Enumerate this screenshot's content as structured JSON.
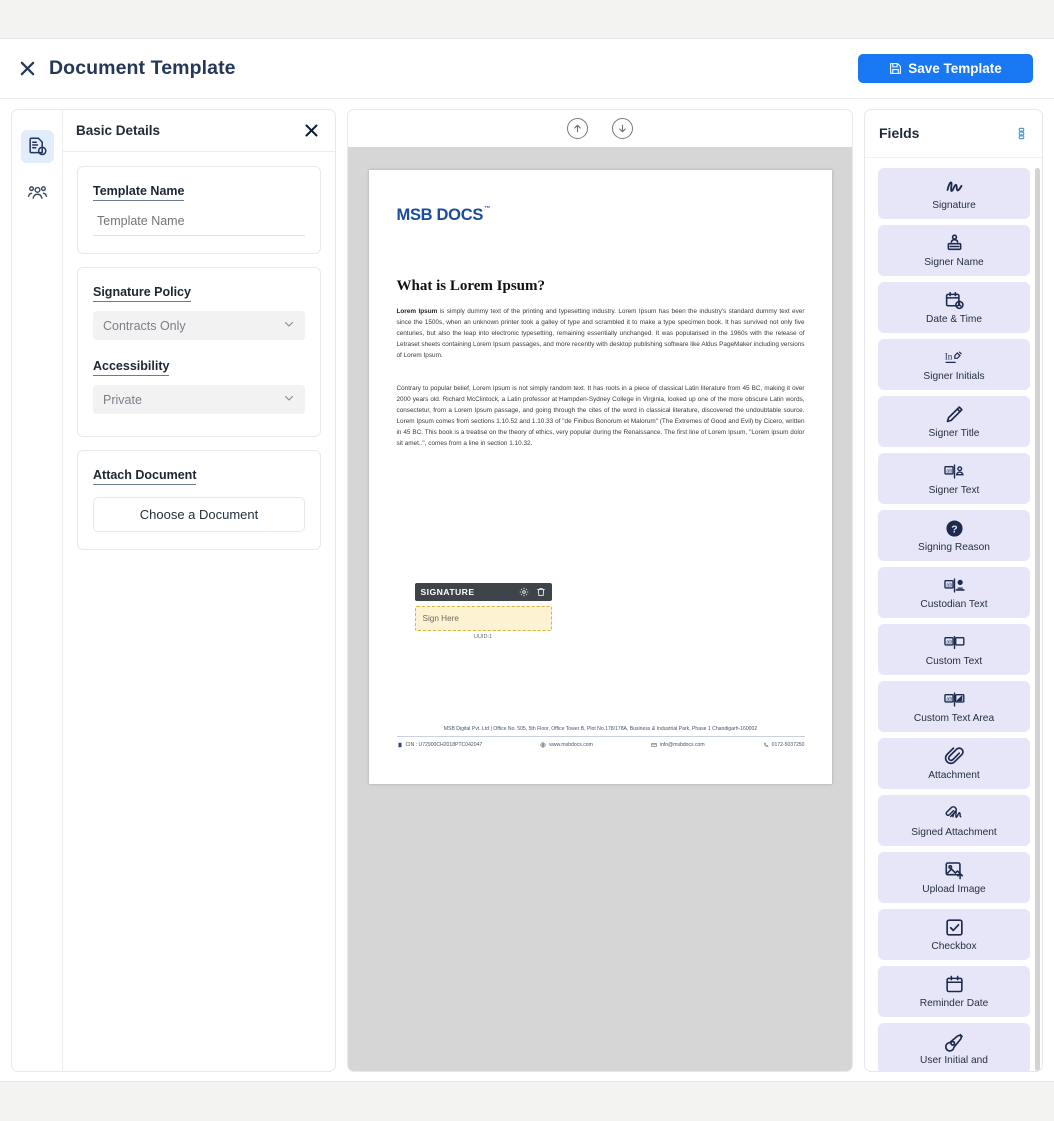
{
  "header": {
    "close_icon": "close-icon",
    "title": "Document Template",
    "save_label": "Save Template",
    "save_icon": "save-disk-icon",
    "accent_color": "#1877f2"
  },
  "rail": {
    "items": [
      {
        "icon": "document-info-icon",
        "name": "basic-details",
        "active": true
      },
      {
        "icon": "recipients-group-icon",
        "name": "recipients",
        "active": false
      }
    ]
  },
  "left_panel": {
    "title": "Basic Details",
    "close_icon": "close-icon",
    "template_name": {
      "label": "Template Name",
      "value": "",
      "placeholder": "Template Name"
    },
    "signature_policy": {
      "label": "Signature Policy",
      "value": "Contracts Only",
      "chevron": "chevron-down-icon"
    },
    "accessibility": {
      "label": "Accessibility",
      "value": "Private",
      "chevron": "chevron-down-icon"
    },
    "attach_document": {
      "label": "Attach Document",
      "button_label": "Choose a Document"
    }
  },
  "viewer": {
    "toolbar": [
      {
        "name": "previous-page-button",
        "icon": "arrow-up-circle-icon"
      },
      {
        "name": "next-page-button",
        "icon": "arrow-down-circle-icon"
      }
    ],
    "document": {
      "logo": "MSB DOCS",
      "logo_tm": "™",
      "heading": "What is Lorem Ipsum?",
      "paragraph1_lead": "Lorem Ipsum",
      "paragraph1": " is simply dummy text of the printing and typesetting industry. Lorem Ipsum has been the industry's standard dummy text ever since the 1500s, when an unknown printer took a galley of type and scrambled it to make a type specimen book. It has survived not only five centuries, but also the leap into electronic typesetting, remaining essentially unchanged. It was popularised in the 1960s with the release of Letraset sheets containing Lorem Ipsum passages, and more recently with desktop publishing software like Aldus PageMaker including versions of Lorem Ipsum.",
      "paragraph2": "Contrary to popular belief, Lorem Ipsum is not simply random text. It has roots in a piece of classical Latin literature from 45 BC, making it over 2000 years old. Richard McClintock, a Latin professor at Hampden-Sydney College in Virginia, looked up one of the more obscure Latin words, consectetur, from a Lorem Ipsum passage, and going through the cites of the word in classical literature, discovered the undoubtable source. Lorem Ipsum comes from sections 1.10.52 and 1.10.33 of \"de Finibus Bonorum et Malorum\" (The Extremes of Good and Evil) by Cicero, written in 45 BC. This book is a treatise on the theory of ethics, very popular during the Renaissance. The first line of Lorem Ipsum, \"Lorem ipsum dolor sit amet..\", comes from a line in section 1.10.32.",
      "signature_field": {
        "header_label": "SIGNATURE",
        "settings_icon": "gear-icon",
        "delete_icon": "trash-icon",
        "placeholder": "Sign Here",
        "uuid": "UUID:1",
        "fill_color": "#fdf2d2",
        "border_color": "#d8b445"
      },
      "footer": {
        "address": "MSB Digital Pvt. Ltd |  Office No. 505, 5th Floor, Office Tower B, Plot No.178/178A, Business & Industrial Park, Phase 1 Chandigarh-160002",
        "cin": "CIN : U72900CH2018PTC042047",
        "cin_icon": "building-icon",
        "website": "www.msbdocs.com",
        "website_icon": "globe-icon",
        "email": "info@msbdocs.com",
        "email_icon": "mail-icon",
        "phone": "0172-5037250",
        "phone_icon": "phone-icon"
      }
    }
  },
  "fields_panel": {
    "title": "Fields",
    "menu_icon": "list-stack-icon",
    "items": [
      {
        "label": "Signature",
        "icon": "signature-scribble-icon"
      },
      {
        "label": "Signer Name",
        "icon": "signer-name-icon"
      },
      {
        "label": "Date & Time",
        "icon": "calendar-clock-icon"
      },
      {
        "label": "Signer Initials",
        "icon": "initials-pen-icon"
      },
      {
        "label": "Signer Title",
        "icon": "pencil-icon"
      },
      {
        "label": "Signer Text",
        "icon": "text-person-icon"
      },
      {
        "label": "Signing Reason",
        "icon": "question-circle-icon"
      },
      {
        "label": "Custodian Text",
        "icon": "text-custodian-icon"
      },
      {
        "label": "Custom Text",
        "icon": "text-box-icon"
      },
      {
        "label": "Custom Text Area",
        "icon": "text-area-icon"
      },
      {
        "label": "Attachment",
        "icon": "paperclip-icon"
      },
      {
        "label": "Signed Attachment",
        "icon": "signed-paperclip-icon"
      },
      {
        "label": "Upload Image",
        "icon": "image-upload-icon"
      },
      {
        "label": "Checkbox",
        "icon": "checkbox-icon"
      },
      {
        "label": "Reminder Date",
        "icon": "calendar-icon"
      },
      {
        "label": "User Initial and",
        "icon": "fountain-pen-icon"
      }
    ],
    "tile_color": "#e7e6f8"
  }
}
